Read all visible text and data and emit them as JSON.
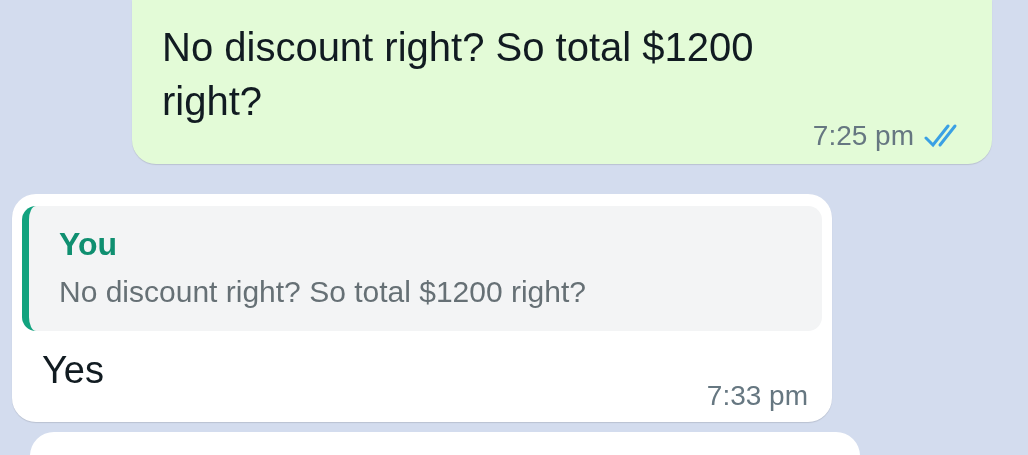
{
  "messages": [
    {
      "kind": "outgoing",
      "text": "No discount right? So total $1200 right?",
      "time": "7:25 pm",
      "read": true
    },
    {
      "kind": "incoming",
      "quote": {
        "author": "You",
        "text": "No discount right? So total $1200 right?"
      },
      "text": "Yes",
      "time": "7:33 pm"
    },
    {
      "kind": "incoming-partial"
    }
  ]
}
